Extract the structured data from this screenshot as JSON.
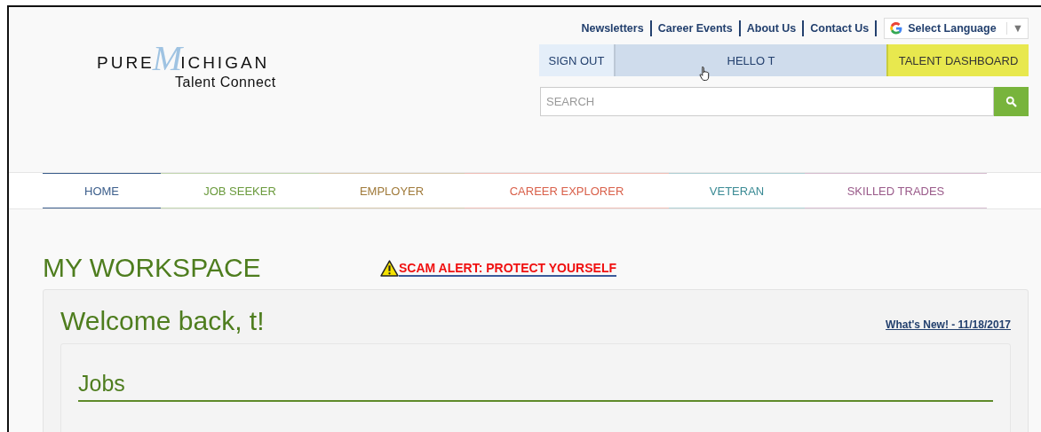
{
  "logo": {
    "word_1": "PURE",
    "initial": "M",
    "word_2": "ICHIGAN",
    "subtitle": "Talent Connect"
  },
  "top_links": [
    "Newsletters",
    "Career Events",
    "About Us",
    "Contact Us"
  ],
  "language": {
    "label": "Select Language",
    "caret": "▼"
  },
  "account_bar": {
    "sign_out": "SIGN OUT",
    "greeting": "HELLO T",
    "dashboard": "TALENT DASHBOARD"
  },
  "search": {
    "placeholder": "SEARCH"
  },
  "nav": [
    {
      "label": "HOME",
      "color": "#3d5f8c",
      "selected": true
    },
    {
      "label": "JOB SEEKER",
      "color": "#6a9a3c",
      "selected": false
    },
    {
      "label": "EMPLOYER",
      "color": "#a07a3a",
      "selected": false
    },
    {
      "label": "CAREER EXPLORER",
      "color": "#d9604a",
      "selected": false
    },
    {
      "label": "VETERAN",
      "color": "#3a8a94",
      "selected": false
    },
    {
      "label": "SKILLED TRADES",
      "color": "#9a5a8a",
      "selected": false
    }
  ],
  "page_title": "MY WORKSPACE",
  "alert": "SCAM ALERT: PROTECT YOURSELF",
  "welcome": "Welcome back, t!",
  "whats_new": "What's New! - 11/18/2017",
  "section_title": "Jobs"
}
